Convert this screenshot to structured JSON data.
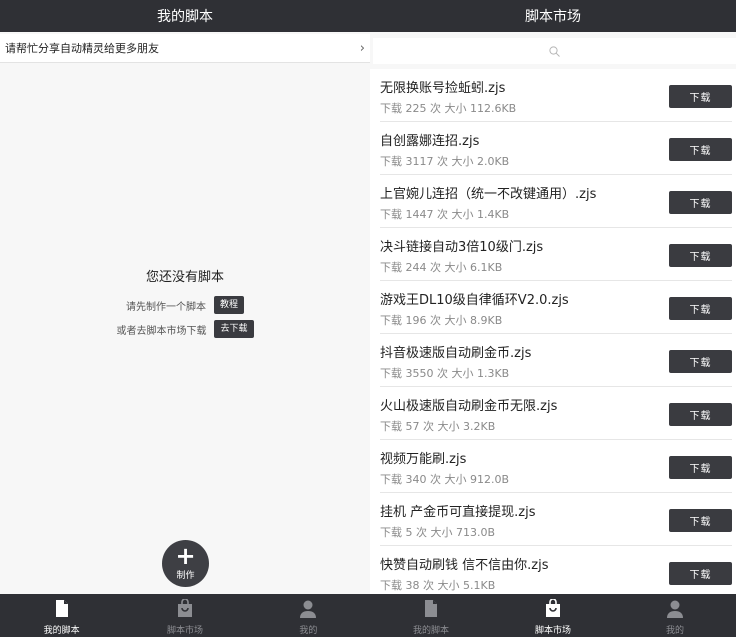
{
  "left": {
    "title": "我的脚本",
    "banner": {
      "text": "请帮忙分享自动精灵给更多朋友",
      "chevron": "›"
    },
    "empty": {
      "title": "您还没有脚本",
      "line1": "请先制作一个脚本",
      "line1_button": "教程",
      "line2": "或者去脚本市场下载",
      "line2_button": "去下载"
    },
    "fab": {
      "icon": "+",
      "label": "制作"
    }
  },
  "right": {
    "title": "脚本市场",
    "download_label": "下载",
    "items": [
      {
        "name": "无限换账号捡蚯蚓.zjs",
        "meta": "下载 225 次 大小 112.6KB"
      },
      {
        "name": "自创露娜连招.zjs",
        "meta": "下载 3117 次 大小 2.0KB"
      },
      {
        "name": "上官婉儿连招（统一不改键通用）.zjs",
        "meta": "下载 1447 次 大小 1.4KB"
      },
      {
        "name": "决斗链接自动3倍10级门.zjs",
        "meta": "下载 244 次 大小 6.1KB"
      },
      {
        "name": "游戏王DL10级自律循环V2.0.zjs",
        "meta": "下载 196 次 大小 8.9KB"
      },
      {
        "name": "抖音极速版自动刷金币.zjs",
        "meta": "下载 3550 次 大小 1.3KB"
      },
      {
        "name": "火山极速版自动刷金币无限.zjs",
        "meta": "下载 57 次 大小 3.2KB"
      },
      {
        "name": "视频万能刷.zjs",
        "meta": "下载 340 次 大小 912.0B"
      },
      {
        "name": "挂机 产金币可直接提现.zjs",
        "meta": "下载 5 次 大小 713.0B"
      },
      {
        "name": "快赞自动刷钱 信不信由你.zjs",
        "meta": "下载 38 次 大小 5.1KB"
      }
    ]
  },
  "tabs": [
    {
      "label": "我的脚本",
      "icon": "document-icon"
    },
    {
      "label": "脚本市场",
      "icon": "shopping-bag-icon"
    },
    {
      "label": "我的",
      "icon": "user-icon"
    }
  ],
  "colors": {
    "bar": "#2f3035",
    "button": "#3a3b40",
    "active_tab": "#ffffff",
    "inactive_tab": "#8c8d92"
  }
}
